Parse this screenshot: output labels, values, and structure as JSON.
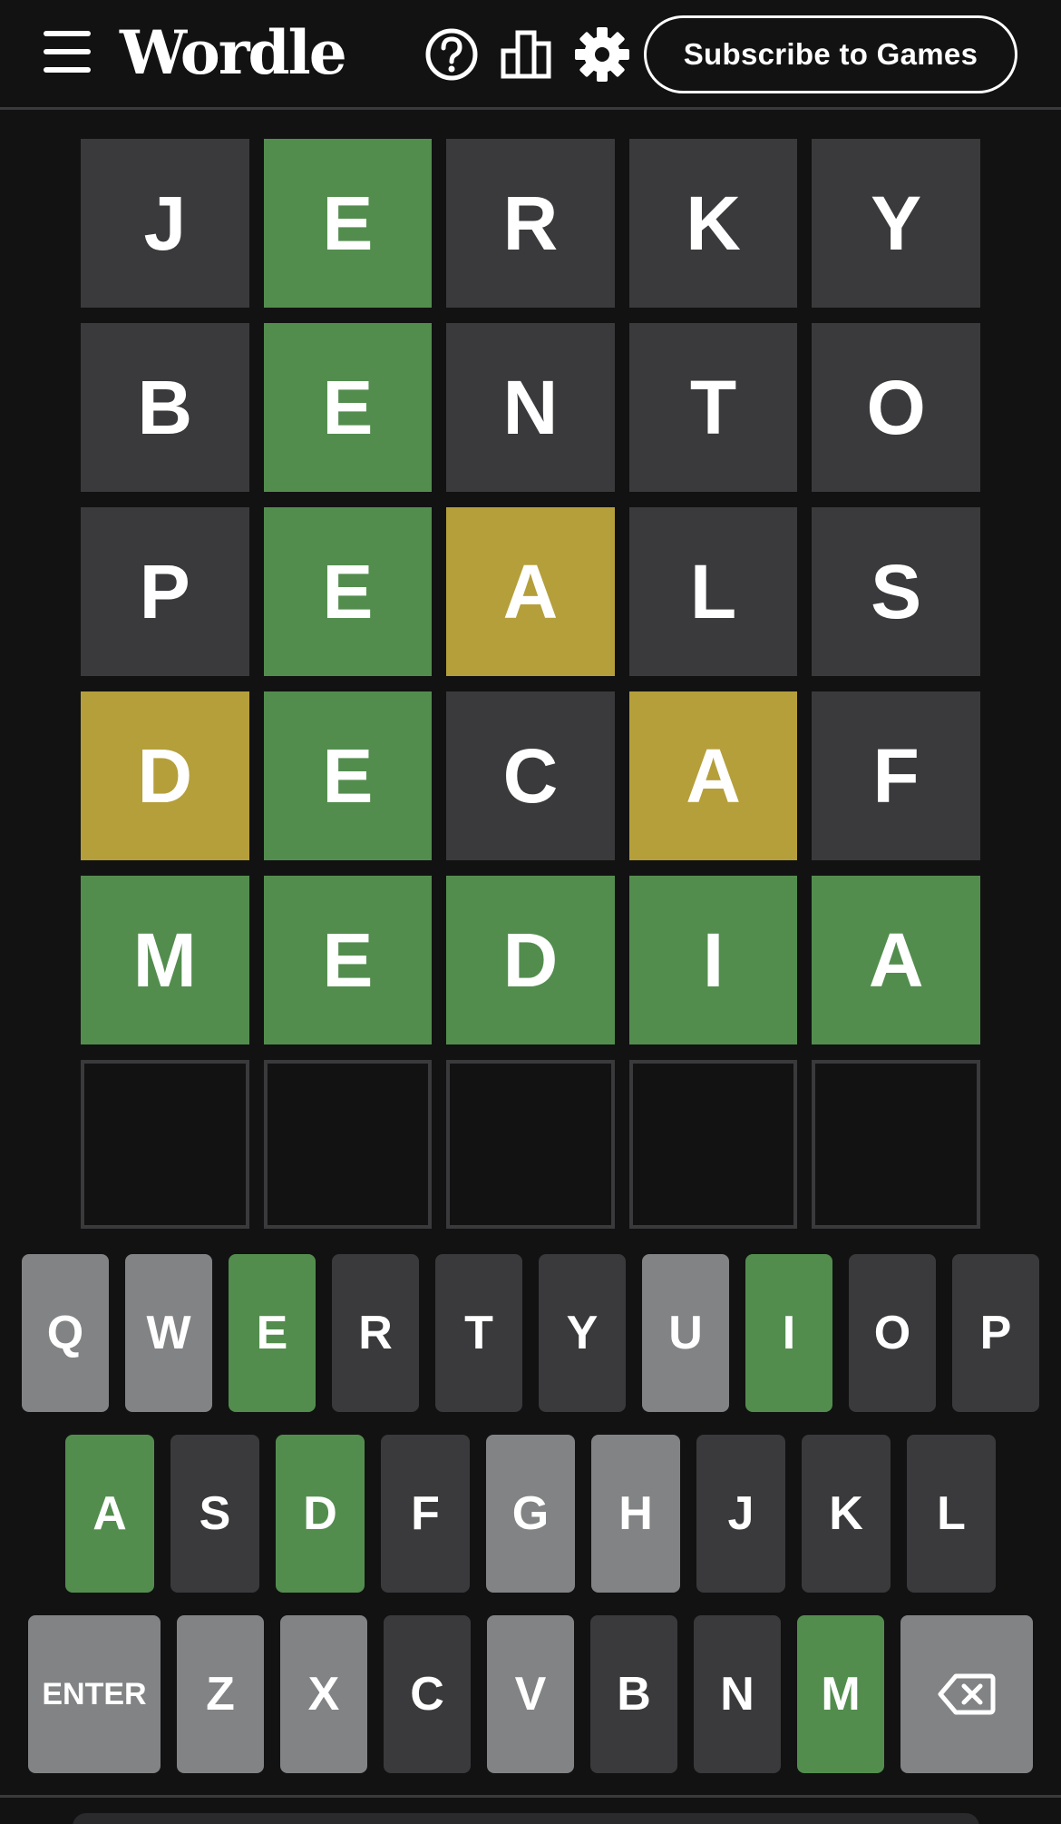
{
  "header": {
    "title": "Wordle",
    "subscribe_label": "Subscribe to Games",
    "icons": [
      "menu-icon",
      "help-icon",
      "stats-icon",
      "settings-icon"
    ]
  },
  "colors": {
    "background": "#121213",
    "correct": "#538d4e",
    "present": "#b59f3b",
    "absent": "#3a3a3c",
    "unused_key": "#818384"
  },
  "board": [
    [
      {
        "letter": "J",
        "state": "absent"
      },
      {
        "letter": "E",
        "state": "correct"
      },
      {
        "letter": "R",
        "state": "absent"
      },
      {
        "letter": "K",
        "state": "absent"
      },
      {
        "letter": "Y",
        "state": "absent"
      }
    ],
    [
      {
        "letter": "B",
        "state": "absent"
      },
      {
        "letter": "E",
        "state": "correct"
      },
      {
        "letter": "N",
        "state": "absent"
      },
      {
        "letter": "T",
        "state": "absent"
      },
      {
        "letter": "O",
        "state": "absent"
      }
    ],
    [
      {
        "letter": "P",
        "state": "absent"
      },
      {
        "letter": "E",
        "state": "correct"
      },
      {
        "letter": "A",
        "state": "present"
      },
      {
        "letter": "L",
        "state": "absent"
      },
      {
        "letter": "S",
        "state": "absent"
      }
    ],
    [
      {
        "letter": "D",
        "state": "present"
      },
      {
        "letter": "E",
        "state": "correct"
      },
      {
        "letter": "C",
        "state": "absent"
      },
      {
        "letter": "A",
        "state": "present"
      },
      {
        "letter": "F",
        "state": "absent"
      }
    ],
    [
      {
        "letter": "M",
        "state": "correct"
      },
      {
        "letter": "E",
        "state": "correct"
      },
      {
        "letter": "D",
        "state": "correct"
      },
      {
        "letter": "I",
        "state": "correct"
      },
      {
        "letter": "A",
        "state": "correct"
      }
    ],
    [
      {
        "letter": "",
        "state": "empty"
      },
      {
        "letter": "",
        "state": "empty"
      },
      {
        "letter": "",
        "state": "empty"
      },
      {
        "letter": "",
        "state": "empty"
      },
      {
        "letter": "",
        "state": "empty"
      }
    ]
  ],
  "keyboard": [
    [
      {
        "key": "Q",
        "state": "unused"
      },
      {
        "key": "W",
        "state": "unused"
      },
      {
        "key": "E",
        "state": "correct"
      },
      {
        "key": "R",
        "state": "absent"
      },
      {
        "key": "T",
        "state": "absent"
      },
      {
        "key": "Y",
        "state": "absent"
      },
      {
        "key": "U",
        "state": "unused"
      },
      {
        "key": "I",
        "state": "correct"
      },
      {
        "key": "O",
        "state": "absent"
      },
      {
        "key": "P",
        "state": "absent"
      }
    ],
    [
      {
        "key": "A",
        "state": "correct"
      },
      {
        "key": "S",
        "state": "absent"
      },
      {
        "key": "D",
        "state": "correct"
      },
      {
        "key": "F",
        "state": "absent"
      },
      {
        "key": "G",
        "state": "unused"
      },
      {
        "key": "H",
        "state": "unused"
      },
      {
        "key": "J",
        "state": "absent"
      },
      {
        "key": "K",
        "state": "absent"
      },
      {
        "key": "L",
        "state": "absent"
      }
    ],
    [
      {
        "key": "ENTER",
        "state": "unused"
      },
      {
        "key": "Z",
        "state": "unused"
      },
      {
        "key": "X",
        "state": "unused"
      },
      {
        "key": "C",
        "state": "absent"
      },
      {
        "key": "V",
        "state": "unused"
      },
      {
        "key": "B",
        "state": "absent"
      },
      {
        "key": "N",
        "state": "absent"
      },
      {
        "key": "M",
        "state": "correct"
      },
      {
        "key": "backspace-icon",
        "state": "unused",
        "icon": true
      }
    ]
  ]
}
